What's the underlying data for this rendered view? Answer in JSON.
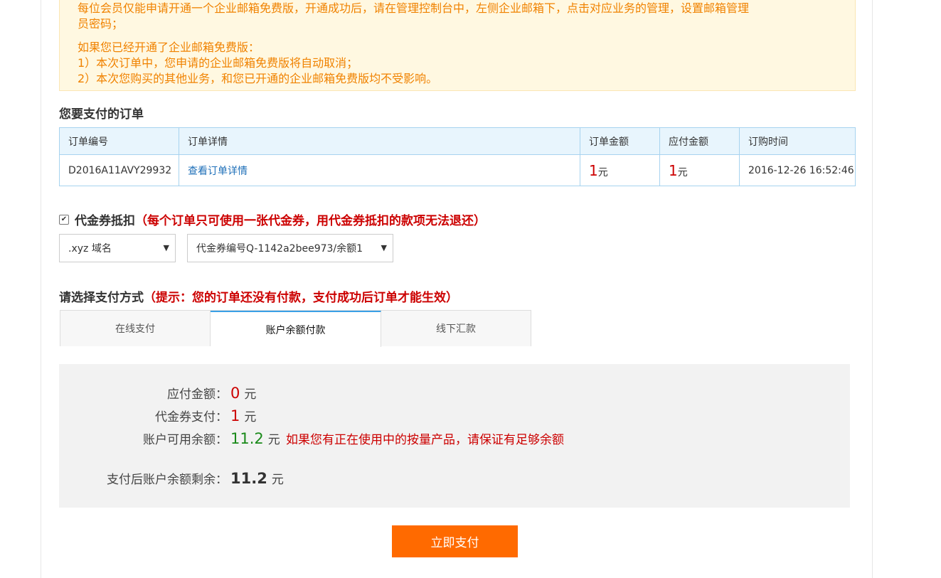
{
  "notice": {
    "line1": "每位会员仅能申请开通一个企业邮箱免费版，开通成功后，请在管理控制台中，左侧企业邮箱下，点击对应业务的管理，设置邮箱管理",
    "line1b": "员密码；",
    "line2": "如果您已经开通了企业邮箱免费版：",
    "line3": "1）本次订单中，您申请的企业邮箱免费版将自动取消；",
    "line4": "2）本次您购买的其他业务，和您已开通的企业邮箱免费版均不受影响。"
  },
  "orders_section": {
    "title": "您要支付的订单",
    "headers": [
      "订单编号",
      "订单详情",
      "订单金额",
      "应付金额",
      "订购时间"
    ],
    "row": {
      "order_no": "D2016A11AVY29932",
      "detail_link": "查看订单详情",
      "order_amount": "1",
      "payable_amount": "1",
      "unit": "元",
      "order_time": "2016-12-26 16:52:46"
    }
  },
  "voucher": {
    "checked": true,
    "label": "代金券抵扣",
    "hint": "（每个订单只可使用一张代金券，用代金券抵扣的款项无法退还）",
    "category_select": ".xyz 域名",
    "voucher_select": "代金券编号Q-1142a2bee973/余额1"
  },
  "payment": {
    "title": "请选择支付方式",
    "hint": "（提示：您的订单还没有付款，支付成功后订单才能生效）",
    "tabs": [
      "在线支付",
      "账户余额付款",
      "线下汇款"
    ],
    "active_tab": 1,
    "rows": {
      "payable_label": "应付金额：",
      "payable_value": "0",
      "voucher_label": "代金券支付：",
      "voucher_value": "1",
      "balance_label": "账户可用余额：",
      "balance_value": "11.2",
      "balance_warning": "如果您有正在使用中的按量产品，请保证有足够余额",
      "remaining_label": "支付后账户余额剩余：",
      "remaining_value": "11.2",
      "unit": "元"
    },
    "pay_button": "立即支付"
  }
}
